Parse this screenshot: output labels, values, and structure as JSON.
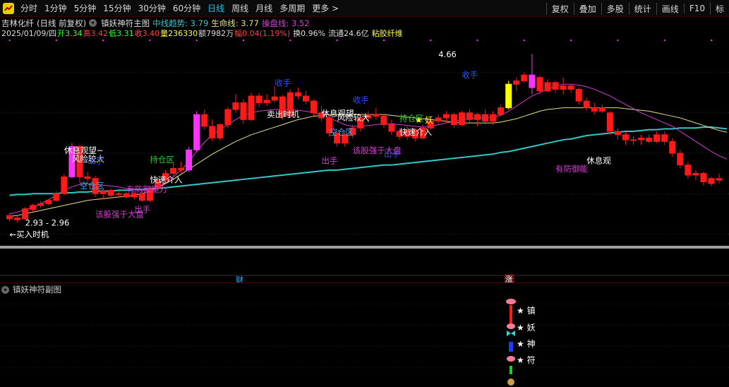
{
  "toolbar": {
    "periods": [
      "分时",
      "1分钟",
      "5分钟",
      "15分钟",
      "30分钟",
      "60分钟",
      "日线",
      "周线",
      "月线",
      "多周期",
      "更多 >"
    ],
    "active_index": 6,
    "right_items": [
      "复权",
      "叠加",
      "多股",
      "统计",
      "画线",
      "F10",
      "标"
    ]
  },
  "header": {
    "stock_name": "吉林化纤",
    "chart_mode": "(日线 前复权)",
    "indicator": "镇妖神符主图",
    "mid_trend_label": "中线趋势: 3.79",
    "life_line_label": "生命线: 3.77",
    "control_line_label": "操盘线: 3.52"
  },
  "info": {
    "date": "2025/01/09/四",
    "open": "开3.34",
    "high": "高3.42",
    "low": "低3.31",
    "close": "收3.40",
    "volume": "量236330",
    "amount": "额7982万",
    "change": "幅0.04(1.19%)",
    "turnover": "换0.96%",
    "float_cap": "流通24.6亿",
    "sector": "粘胶纤维"
  },
  "colors": {
    "up": "#ff1a1a",
    "down": "#00ccff",
    "magenta": "#ff33ff",
    "yellow": "#ffff00",
    "cyan_line": "#33c8c8",
    "pink_line": "#d040d0",
    "yellow_line": "#e6e080",
    "blue_text": "#2f4cff",
    "gray_bar": "#a0a0a0"
  },
  "chart_data": {
    "type": "candlestick",
    "price_range": [
      2.5,
      4.9
    ],
    "candles": [
      {
        "o": 2.96,
        "h": 2.99,
        "l": 2.89,
        "c": 2.92,
        "hl": 0
      },
      {
        "o": 2.91,
        "h": 2.95,
        "l": 2.88,
        "c": 2.93,
        "hl": 0
      },
      {
        "o": 2.92,
        "h": 3.06,
        "l": 2.91,
        "c": 3.04,
        "hl": 0
      },
      {
        "o": 3.03,
        "h": 3.1,
        "l": 3.0,
        "c": 3.08,
        "hl": 0
      },
      {
        "o": 3.08,
        "h": 3.13,
        "l": 3.05,
        "c": 3.1,
        "hl": 0
      },
      {
        "o": 3.1,
        "h": 3.15,
        "l": 3.08,
        "c": 3.14,
        "hl": 0
      },
      {
        "o": 3.14,
        "h": 3.25,
        "l": 3.12,
        "c": 3.22,
        "hl": 0
      },
      {
        "o": 3.22,
        "h": 3.45,
        "l": 3.2,
        "c": 3.42,
        "hl": 0
      },
      {
        "o": 3.42,
        "h": 3.82,
        "l": 3.4,
        "c": 3.78,
        "hl": 1
      },
      {
        "o": 3.78,
        "h": 3.8,
        "l": 3.35,
        "c": 3.42,
        "hl": 0
      },
      {
        "o": 3.42,
        "h": 3.48,
        "l": 3.35,
        "c": 3.4,
        "hl": 0
      },
      {
        "o": 3.4,
        "h": 3.43,
        "l": 3.18,
        "c": 3.22,
        "hl": 0
      },
      {
        "o": 3.22,
        "h": 3.28,
        "l": 3.15,
        "c": 3.25,
        "hl": 0
      },
      {
        "o": 3.26,
        "h": 3.28,
        "l": 3.18,
        "c": 3.2,
        "hl": 0
      },
      {
        "o": 3.21,
        "h": 3.25,
        "l": 3.17,
        "c": 3.22,
        "hl": 0
      },
      {
        "o": 3.22,
        "h": 3.24,
        "l": 3.16,
        "c": 3.18,
        "hl": 0
      },
      {
        "o": 3.18,
        "h": 3.25,
        "l": 3.15,
        "c": 3.22,
        "hl": 0
      },
      {
        "o": 3.22,
        "h": 3.28,
        "l": 3.12,
        "c": 3.14,
        "hl": 0
      },
      {
        "o": 3.14,
        "h": 3.3,
        "l": 3.12,
        "c": 3.28,
        "hl": 0
      },
      {
        "o": 3.28,
        "h": 3.42,
        "l": 3.25,
        "c": 3.38,
        "hl": 0
      },
      {
        "o": 3.38,
        "h": 3.5,
        "l": 3.35,
        "c": 3.46,
        "hl": 0
      },
      {
        "o": 3.46,
        "h": 3.58,
        "l": 3.42,
        "c": 3.52,
        "hl": 0
      },
      {
        "o": 3.52,
        "h": 3.6,
        "l": 3.46,
        "c": 3.5,
        "hl": 0
      },
      {
        "o": 3.5,
        "h": 3.78,
        "l": 3.48,
        "c": 3.74,
        "hl": 1
      },
      {
        "o": 3.74,
        "h": 4.2,
        "l": 3.72,
        "c": 4.16,
        "hl": 1
      },
      {
        "o": 4.16,
        "h": 4.22,
        "l": 3.98,
        "c": 4.02,
        "hl": 0
      },
      {
        "o": 4.02,
        "h": 4.1,
        "l": 3.84,
        "c": 3.88,
        "hl": 0
      },
      {
        "o": 3.88,
        "h": 4.06,
        "l": 3.85,
        "c": 4.04,
        "hl": 0
      },
      {
        "o": 4.04,
        "h": 4.25,
        "l": 4.0,
        "c": 4.22,
        "hl": 0
      },
      {
        "o": 4.22,
        "h": 4.4,
        "l": 4.18,
        "c": 4.3,
        "hl": 0
      },
      {
        "o": 4.3,
        "h": 4.34,
        "l": 4.05,
        "c": 4.1,
        "hl": 0
      },
      {
        "o": 4.1,
        "h": 4.42,
        "l": 4.08,
        "c": 4.38,
        "hl": 0
      },
      {
        "o": 4.38,
        "h": 4.42,
        "l": 4.25,
        "c": 4.3,
        "hl": 0
      },
      {
        "o": 4.3,
        "h": 4.4,
        "l": 4.26,
        "c": 4.33,
        "hl": 0
      },
      {
        "o": 4.33,
        "h": 4.5,
        "l": 4.3,
        "c": 4.37,
        "hl": 0
      },
      {
        "o": 4.37,
        "h": 4.39,
        "l": 4.1,
        "c": 4.14,
        "hl": 0
      },
      {
        "o": 4.14,
        "h": 4.46,
        "l": 4.12,
        "c": 4.42,
        "hl": 0
      },
      {
        "o": 4.42,
        "h": 4.48,
        "l": 4.34,
        "c": 4.38,
        "hl": 0
      },
      {
        "o": 4.38,
        "h": 4.44,
        "l": 4.28,
        "c": 4.32,
        "hl": 0
      },
      {
        "o": 4.32,
        "h": 4.34,
        "l": 4.14,
        "c": 4.18,
        "hl": 0
      },
      {
        "o": 4.18,
        "h": 4.26,
        "l": 4.08,
        "c": 4.12,
        "hl": 0
      },
      {
        "o": 4.12,
        "h": 4.16,
        "l": 3.9,
        "c": 3.94,
        "hl": 0
      },
      {
        "o": 3.94,
        "h": 3.96,
        "l": 3.78,
        "c": 3.82,
        "hl": 0
      },
      {
        "o": 3.82,
        "h": 3.96,
        "l": 3.78,
        "c": 3.92,
        "hl": 0
      },
      {
        "o": 3.92,
        "h": 4.04,
        "l": 3.88,
        "c": 4.0,
        "hl": 0
      },
      {
        "o": 4.0,
        "h": 4.16,
        "l": 3.96,
        "c": 4.12,
        "hl": 0
      },
      {
        "o": 4.12,
        "h": 4.2,
        "l": 4.06,
        "c": 4.16,
        "hl": 0
      },
      {
        "o": 4.16,
        "h": 4.24,
        "l": 4.1,
        "c": 4.14,
        "hl": 0
      },
      {
        "o": 4.14,
        "h": 4.16,
        "l": 4.0,
        "c": 4.04,
        "hl": 0
      },
      {
        "o": 4.04,
        "h": 4.1,
        "l": 3.92,
        "c": 3.96,
        "hl": 0
      },
      {
        "o": 3.96,
        "h": 4.0,
        "l": 3.86,
        "c": 3.9,
        "hl": 0
      },
      {
        "o": 3.9,
        "h": 4.02,
        "l": 3.86,
        "c": 3.98,
        "hl": 0
      },
      {
        "o": 3.98,
        "h": 4.0,
        "l": 3.84,
        "c": 3.88,
        "hl": 0
      },
      {
        "o": 3.88,
        "h": 4.04,
        "l": 3.86,
        "c": 4.0,
        "hl": 0
      },
      {
        "o": 4.0,
        "h": 4.12,
        "l": 3.98,
        "c": 4.08,
        "hl": 0
      },
      {
        "o": 4.08,
        "h": 4.16,
        "l": 4.04,
        "c": 4.12,
        "hl": 0
      },
      {
        "o": 4.12,
        "h": 4.2,
        "l": 4.06,
        "c": 4.16,
        "hl": 0
      },
      {
        "o": 4.16,
        "h": 4.18,
        "l": 4.0,
        "c": 4.04,
        "hl": 0
      },
      {
        "o": 4.04,
        "h": 4.2,
        "l": 4.02,
        "c": 4.18,
        "hl": 0
      },
      {
        "o": 4.18,
        "h": 4.22,
        "l": 4.06,
        "c": 4.1,
        "hl": 0
      },
      {
        "o": 4.1,
        "h": 4.18,
        "l": 4.02,
        "c": 4.16,
        "hl": 0
      },
      {
        "o": 4.16,
        "h": 4.22,
        "l": 4.04,
        "c": 4.08,
        "hl": 0
      },
      {
        "o": 4.08,
        "h": 4.2,
        "l": 4.04,
        "c": 4.16,
        "hl": 0
      },
      {
        "o": 4.16,
        "h": 4.28,
        "l": 4.14,
        "c": 4.24,
        "hl": 0
      },
      {
        "o": 4.24,
        "h": 4.56,
        "l": 4.22,
        "c": 4.52,
        "hl": 2
      },
      {
        "o": 4.52,
        "h": 4.6,
        "l": 4.44,
        "c": 4.56,
        "hl": 0
      },
      {
        "o": 4.56,
        "h": 4.66,
        "l": 4.54,
        "c": 4.63,
        "hl": 0
      },
      {
        "o": 4.48,
        "h": 4.88,
        "l": 4.4,
        "c": 4.63,
        "hl": 1
      },
      {
        "o": 4.6,
        "h": 4.62,
        "l": 4.4,
        "c": 4.44,
        "hl": 0
      },
      {
        "o": 4.44,
        "h": 4.58,
        "l": 4.42,
        "c": 4.54,
        "hl": 0
      },
      {
        "o": 4.54,
        "h": 4.56,
        "l": 4.42,
        "c": 4.46,
        "hl": 0
      },
      {
        "o": 4.46,
        "h": 4.6,
        "l": 4.4,
        "c": 4.5,
        "hl": 0
      },
      {
        "o": 4.5,
        "h": 4.52,
        "l": 4.42,
        "c": 4.46,
        "hl": 0
      },
      {
        "o": 4.46,
        "h": 4.48,
        "l": 4.28,
        "c": 4.32,
        "hl": 0
      },
      {
        "o": 4.32,
        "h": 4.36,
        "l": 4.2,
        "c": 4.24,
        "hl": 0
      },
      {
        "o": 4.24,
        "h": 4.3,
        "l": 4.16,
        "c": 4.2,
        "hl": 0
      },
      {
        "o": 4.2,
        "h": 4.28,
        "l": 4.18,
        "c": 4.24,
        "hl": 0
      },
      {
        "o": 4.18,
        "h": 4.2,
        "l": 3.92,
        "c": 3.96,
        "hl": 0
      },
      {
        "o": 3.96,
        "h": 4.0,
        "l": 3.86,
        "c": 3.92,
        "hl": 0
      },
      {
        "o": 3.92,
        "h": 3.96,
        "l": 3.8,
        "c": 3.86,
        "hl": 0
      },
      {
        "o": 3.86,
        "h": 3.9,
        "l": 3.8,
        "c": 3.86,
        "hl": 0
      },
      {
        "o": 3.86,
        "h": 3.92,
        "l": 3.8,
        "c": 3.88,
        "hl": 0
      },
      {
        "o": 3.88,
        "h": 3.92,
        "l": 3.82,
        "c": 3.84,
        "hl": 0
      },
      {
        "o": 3.84,
        "h": 3.96,
        "l": 3.82,
        "c": 3.92,
        "hl": 0
      },
      {
        "o": 3.92,
        "h": 3.96,
        "l": 3.8,
        "c": 3.84,
        "hl": 0
      },
      {
        "o": 3.84,
        "h": 3.88,
        "l": 3.66,
        "c": 3.7,
        "hl": 0
      },
      {
        "o": 3.7,
        "h": 3.74,
        "l": 3.52,
        "c": 3.56,
        "hl": 0
      },
      {
        "o": 3.56,
        "h": 3.6,
        "l": 3.4,
        "c": 3.44,
        "hl": 0
      },
      {
        "o": 3.44,
        "h": 3.5,
        "l": 3.38,
        "c": 3.46,
        "hl": 0
      },
      {
        "o": 3.46,
        "h": 3.48,
        "l": 3.32,
        "c": 3.36,
        "hl": 0
      },
      {
        "o": 3.34,
        "h": 3.42,
        "l": 3.31,
        "c": 3.4,
        "hl": 0
      },
      {
        "o": 3.4,
        "h": 3.46,
        "l": 3.34,
        "c": 3.38,
        "hl": 0
      }
    ],
    "lines": {
      "cyan": [
        3.2,
        3.21,
        3.21,
        3.22,
        3.22,
        3.22,
        3.22,
        3.23,
        3.23,
        3.24,
        3.24,
        3.25,
        3.25,
        3.25,
        3.26,
        3.26,
        3.27,
        3.27,
        3.28,
        3.28,
        3.29,
        3.3,
        3.31,
        3.32,
        3.33,
        3.34,
        3.35,
        3.36,
        3.37,
        3.38,
        3.39,
        3.4,
        3.41,
        3.42,
        3.43,
        3.44,
        3.45,
        3.46,
        3.47,
        3.48,
        3.49,
        3.5,
        3.5,
        3.51,
        3.52,
        3.53,
        3.54,
        3.55,
        3.56,
        3.56,
        3.57,
        3.58,
        3.59,
        3.6,
        3.61,
        3.62,
        3.63,
        3.64,
        3.65,
        3.66,
        3.67,
        3.68,
        3.69,
        3.71,
        3.72,
        3.74,
        3.76,
        3.78,
        3.8,
        3.82,
        3.84,
        3.86,
        3.87,
        3.89,
        3.91,
        3.92,
        3.93,
        3.94,
        3.95,
        3.96,
        3.96,
        3.97,
        3.98,
        3.98,
        3.99,
        3.99,
        4.0,
        4.0,
        4.0,
        4.01,
        4.01,
        4.0,
        3.99
      ],
      "yellow": [
        2.95,
        2.96,
        2.98,
        3.0,
        3.02,
        3.04,
        3.06,
        3.08,
        3.1,
        3.12,
        3.14,
        3.15,
        3.16,
        3.17,
        3.18,
        3.19,
        3.2,
        3.22,
        3.25,
        3.29,
        3.34,
        3.39,
        3.45,
        3.51,
        3.57,
        3.63,
        3.69,
        3.74,
        3.79,
        3.84,
        3.88,
        3.92,
        3.95,
        3.98,
        4.01,
        4.04,
        4.07,
        4.1,
        4.12,
        4.14,
        4.15,
        4.16,
        4.16,
        4.16,
        4.16,
        4.16,
        4.16,
        4.16,
        4.16,
        4.15,
        4.14,
        4.13,
        4.12,
        4.11,
        4.1,
        4.09,
        4.08,
        4.07,
        4.06,
        4.06,
        4.06,
        4.06,
        4.06,
        4.07,
        4.09,
        4.11,
        4.14,
        4.17,
        4.2,
        4.22,
        4.23,
        4.24,
        4.24,
        4.24,
        4.24,
        4.24,
        4.24,
        4.24,
        4.24,
        4.23,
        4.22,
        4.21,
        4.2,
        4.18,
        4.16,
        4.14,
        4.12,
        4.09,
        4.06,
        4.03,
        4.0,
        3.97,
        3.95
      ],
      "magenta": [
        2.98,
        3.0,
        3.03,
        3.06,
        3.1,
        3.15,
        3.2,
        3.26,
        3.3,
        3.33,
        3.34,
        3.33,
        3.32,
        3.31,
        3.3,
        3.28,
        3.27,
        3.26,
        3.27,
        3.3,
        3.35,
        3.42,
        3.5,
        3.6,
        3.72,
        3.83,
        3.92,
        3.98,
        4.04,
        4.1,
        4.15,
        4.18,
        4.2,
        4.21,
        4.22,
        4.22,
        4.22,
        4.21,
        4.2,
        4.18,
        4.16,
        4.12,
        4.08,
        4.04,
        4.02,
        4.02,
        4.03,
        4.04,
        4.05,
        4.05,
        4.04,
        4.03,
        4.02,
        4.01,
        4.02,
        4.04,
        4.06,
        4.08,
        4.1,
        4.11,
        4.12,
        4.12,
        4.13,
        4.15,
        4.2,
        4.26,
        4.32,
        4.38,
        4.42,
        4.46,
        4.5,
        4.52,
        4.52,
        4.51,
        4.49,
        4.46,
        4.42,
        4.38,
        4.33,
        4.28,
        4.23,
        4.18,
        4.14,
        4.1,
        4.06,
        4.02,
        3.96,
        3.9,
        3.84,
        3.78,
        3.72,
        3.67,
        3.63
      ]
    },
    "annotations": [
      {
        "text": "←买入时机",
        "i": 0,
        "p": 2.7,
        "color": "#ffffff"
      },
      {
        "text": "2.93 - 2.96",
        "i": 2,
        "p": 2.84,
        "color": "#ffffff"
      },
      {
        "text": "休息观望~",
        "i": 7,
        "p": 3.7,
        "color": "#ffffff"
      },
      {
        "text": "风险较大",
        "i": 8,
        "p": 3.6,
        "color": "#ffffff"
      },
      {
        "text": "出手",
        "i": 10,
        "p": 3.58,
        "color": "#2f4cff"
      },
      {
        "text": "空仓区",
        "i": 9,
        "p": 3.28,
        "color": "#2fb4ff"
      },
      {
        "text": "有防御能力",
        "i": 15,
        "p": 3.24,
        "color": "#d040d0"
      },
      {
        "text": "该股强于大盘",
        "i": 11,
        "p": 2.94,
        "color": "#d040d0"
      },
      {
        "text": "出手",
        "i": 16,
        "p": 3.0,
        "color": "#d040d0"
      },
      {
        "text": "持仓区",
        "i": 18,
        "p": 3.59,
        "color": "#33cc33"
      },
      {
        "text": "快速介入",
        "i": 18,
        "p": 3.35,
        "color": "#ffffff"
      },
      {
        "text": "收手",
        "i": 34,
        "p": 4.5,
        "color": "#2f4cff"
      },
      {
        "text": "卖出时机",
        "i": 33,
        "p": 4.13,
        "color": "#ffffff"
      },
      {
        "text": "休息观望",
        "i": 40,
        "p": 4.14,
        "color": "#ffffff"
      },
      {
        "text": "风险较大",
        "i": 42,
        "p": 4.09,
        "color": "#ffffff"
      },
      {
        "text": "空仓区",
        "i": 41,
        "p": 3.92,
        "color": "#2fb4ff"
      },
      {
        "text": "收手",
        "i": 44,
        "p": 4.3,
        "color": "#2f4cff"
      },
      {
        "text": "出手",
        "i": 40,
        "p": 3.58,
        "color": "#d040d0"
      },
      {
        "text": "该股强于大盘",
        "i": 44,
        "p": 3.7,
        "color": "#d040d0"
      },
      {
        "text": "出手",
        "i": 48,
        "p": 3.66,
        "color": "#2f4cff"
      },
      {
        "text": "持仓区",
        "i": 50,
        "p": 4.08,
        "color": "#33cc33"
      },
      {
        "text": "快速介入",
        "i": 50,
        "p": 3.92,
        "color": "#ffffff"
      },
      {
        "text": "★ 妖",
        "i": 52,
        "p": 4.06,
        "color": "#ffff00"
      },
      {
        "text": "4.66",
        "i": 55,
        "p": 4.84,
        "color": "#ffffff"
      },
      {
        "text": "收手",
        "i": 58,
        "p": 4.6,
        "color": "#2f4cff"
      },
      {
        "text": "休息观",
        "i": 74,
        "p": 3.58,
        "color": "#ffffff"
      },
      {
        "text": "有防御能",
        "i": 70,
        "p": 3.48,
        "color": "#d040d0"
      }
    ],
    "markers": {
      "cai": "财",
      "zhang": "涨"
    }
  },
  "sub": {
    "title": "镇妖神符副图",
    "labels": [
      "★ 镇",
      "★ 妖",
      "★ 神",
      "★ 符"
    ]
  }
}
